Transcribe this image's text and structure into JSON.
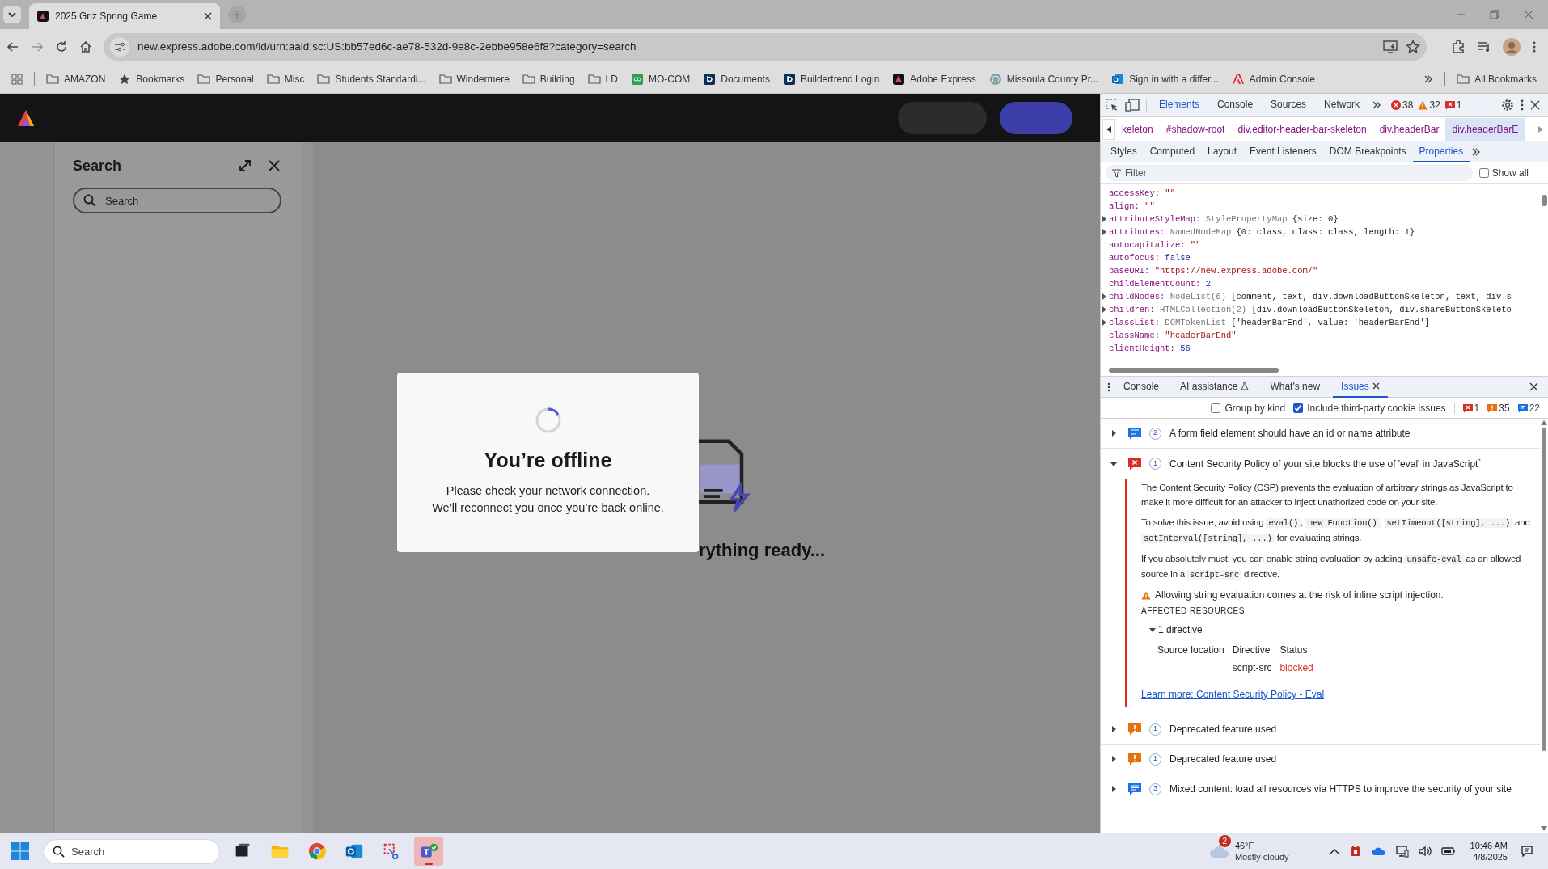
{
  "browser": {
    "tab": {
      "title": "2025 Griz Spring Game"
    },
    "url": "new.express.adobe.com/id/urn:aaid:sc:US:bb57ed6c-ae78-532d-9e8c-2ebbe958e6f8?category=search",
    "bookmarks": [
      {
        "label": "AMAZON",
        "kind": "folder"
      },
      {
        "label": "Bookmarks",
        "kind": "star"
      },
      {
        "label": "Personal",
        "kind": "folder"
      },
      {
        "label": "Misc",
        "kind": "folder"
      },
      {
        "label": "Students Standardi...",
        "kind": "folder"
      },
      {
        "label": "Windermere",
        "kind": "folder"
      },
      {
        "label": "Building",
        "kind": "folder"
      },
      {
        "label": "LD",
        "kind": "folder"
      },
      {
        "label": "MO-COM",
        "kind": "green"
      },
      {
        "label": "Documents",
        "kind": "b"
      },
      {
        "label": "Buildertrend Login",
        "kind": "b"
      },
      {
        "label": "Adobe Express",
        "kind": "express"
      },
      {
        "label": "Missoula County Pr...",
        "kind": "globe"
      },
      {
        "label": "Sign in with a differ...",
        "kind": "outlook"
      },
      {
        "label": "Admin Console",
        "kind": "adobe"
      }
    ],
    "all_bookmarks": "All Bookmarks"
  },
  "app": {
    "search_panel": {
      "title": "Search",
      "placeholder": "Search"
    },
    "loading_text": "rything ready...",
    "dialog": {
      "title": "You’re offline",
      "lines": [
        "Please check your network connection.",
        "We’ll reconnect you once you’re back online."
      ]
    }
  },
  "devtools": {
    "tabs": [
      {
        "label": "Elements",
        "selected": true
      },
      {
        "label": "Console",
        "selected": false
      },
      {
        "label": "Sources",
        "selected": false
      },
      {
        "label": "Network",
        "selected": false
      }
    ],
    "counts": [
      {
        "kind": "error",
        "count": "38"
      },
      {
        "kind": "warning",
        "count": "32"
      },
      {
        "kind": "issue",
        "count": "1"
      }
    ],
    "breadcrumbs": [
      {
        "label": "keleton",
        "selected": false
      },
      {
        "label": "#shadow-root",
        "selected": false
      },
      {
        "label": "div.editor-header-bar-skeleton",
        "selected": false
      },
      {
        "label": "div.headerBar",
        "selected": false
      },
      {
        "label": "div.headerBarE",
        "selected": true
      }
    ],
    "sidebar_tabs": [
      {
        "label": "Styles",
        "selected": false
      },
      {
        "label": "Computed",
        "selected": false
      },
      {
        "label": "Layout",
        "selected": false
      },
      {
        "label": "Event Listeners",
        "selected": false
      },
      {
        "label": "DOM Breakpoints",
        "selected": false
      },
      {
        "label": "Properties",
        "selected": true
      }
    ],
    "filter": {
      "placeholder": "Filter"
    },
    "show_all": {
      "label": "Show all",
      "checked": false
    },
    "properties": [
      {
        "name": "accessKey:",
        "value": "\"\"",
        "kind": "string",
        "expandable": false
      },
      {
        "name": "align:",
        "value": "\"\"",
        "kind": "string",
        "expandable": false
      },
      {
        "name": "attributeStyleMap:",
        "type": "StylePropertyMap",
        "value": "{size: 0}",
        "kind": "object",
        "expandable": true
      },
      {
        "name": "attributes:",
        "type": "NamedNodeMap",
        "value": "{0: class, class: class, length: 1}",
        "kind": "object",
        "expandable": true
      },
      {
        "name": "autocapitalize:",
        "value": "\"\"",
        "kind": "string",
        "expandable": false
      },
      {
        "name": "autofocus:",
        "value": "false",
        "kind": "literal",
        "expandable": false
      },
      {
        "name": "baseURI:",
        "value": "\"https://new.express.adobe.com/\"",
        "kind": "string",
        "expandable": false
      },
      {
        "name": "childElementCount:",
        "value": "2",
        "kind": "literal",
        "expandable": false
      },
      {
        "name": "childNodes:",
        "type": "NodeList(6)",
        "value": "[comment, text, div.downloadButtonSkeleton, text, div.s",
        "kind": "object",
        "expandable": true
      },
      {
        "name": "children:",
        "type": "HTMLCollection(2)",
        "value": "[div.downloadButtonSkeleton, div.shareButtonSkeleto",
        "kind": "object",
        "expandable": true
      },
      {
        "name": "classList:",
        "type": "DOMTokenList",
        "value": "['headerBarEnd', value: 'headerBarEnd']",
        "kind": "object",
        "expandable": true
      },
      {
        "name": "className:",
        "value": "\"headerBarEnd\"",
        "kind": "string",
        "expandable": false
      },
      {
        "name": "clientHeight:",
        "value": "56",
        "kind": "literal",
        "expandable": false
      }
    ],
    "drawer_tabs": [
      {
        "label": "Console",
        "selected": false
      },
      {
        "label": "AI assistance",
        "selected": false,
        "kind": "flask"
      },
      {
        "label": "What's new",
        "selected": false
      },
      {
        "label": "Issues",
        "selected": true,
        "kind": "closable"
      }
    ],
    "group_by_kind": {
      "label": "Group by kind",
      "checked": false
    },
    "third_party": {
      "label": "Include third-party cookie issues",
      "checked": true
    },
    "issue_counts": [
      {
        "kind": "error",
        "count": "1"
      },
      {
        "kind": "warning",
        "count": "35"
      },
      {
        "kind": "info",
        "count": "22"
      }
    ],
    "issues": [
      {
        "kind": "info",
        "count": "2",
        "title": "A form field element should have an id or name attribute",
        "expanded": false
      },
      {
        "kind": "error",
        "count": "1",
        "title": "Content Security Policy of your site blocks the use of 'eval' in JavaScript`",
        "expanded": true,
        "details": {
          "paragraphs": [
            [
              {
                "text": "The Content Security Policy (CSP) prevents the evaluation of arbitrary strings as JavaScript to make it more difficult for an attacker to inject unathorized code on your site.",
                "code": false
              }
            ],
            [
              {
                "text": "To solve this issue, avoid using ",
                "code": false
              },
              {
                "text": "eval()",
                "code": true
              },
              {
                "text": ", ",
                "code": false
              },
              {
                "text": "new Function()",
                "code": true
              },
              {
                "text": ", ",
                "code": false
              },
              {
                "text": "setTimeout([string], ...)",
                "code": true
              },
              {
                "text": " and ",
                "code": false
              },
              {
                "text": "setInterval([string], ...)",
                "code": true
              },
              {
                "text": " for evaluating strings.",
                "code": false
              }
            ],
            [
              {
                "text": "If you absolutely must: you can enable string evaluation by adding ",
                "code": false
              },
              {
                "text": "unsafe-eval",
                "code": true
              },
              {
                "text": " as an allowed source in a ",
                "code": false
              },
              {
                "text": "script-src",
                "code": true
              },
              {
                "text": " directive.",
                "code": false
              }
            ]
          ],
          "warning": "Allowing string evaluation comes at the risk of inline script injection.",
          "affected_heading": "AFFECTED RESOURCES",
          "directive_toggle": "1 directive",
          "columns": [
            "Source location",
            "Directive",
            "Status"
          ],
          "row": {
            "directive": "script-src",
            "status": "blocked"
          },
          "link": "Learn more: Content Security Policy - Eval"
        }
      },
      {
        "kind": "warning",
        "count": "1",
        "title": "Deprecated feature used",
        "expanded": false
      },
      {
        "kind": "warning",
        "count": "1",
        "title": "Deprecated feature used",
        "expanded": false
      },
      {
        "kind": "info",
        "count": "3",
        "title": "Mixed content: load all resources via HTTPS to improve the security of your site",
        "expanded": false
      }
    ]
  },
  "taskbar": {
    "search_placeholder": "Search",
    "apps": [
      {
        "kind": "taskview",
        "selected": false
      },
      {
        "kind": "explorer",
        "selected": false
      },
      {
        "kind": "chrome",
        "selected": false
      },
      {
        "kind": "outlook",
        "selected": false
      },
      {
        "kind": "snip",
        "selected": false
      },
      {
        "kind": "teams",
        "selected": true
      }
    ],
    "weather": {
      "badge": "2",
      "temp": "46°F",
      "condition": "Mostly cloudy"
    },
    "time": "10:46 AM",
    "date": "4/8/2025"
  }
}
